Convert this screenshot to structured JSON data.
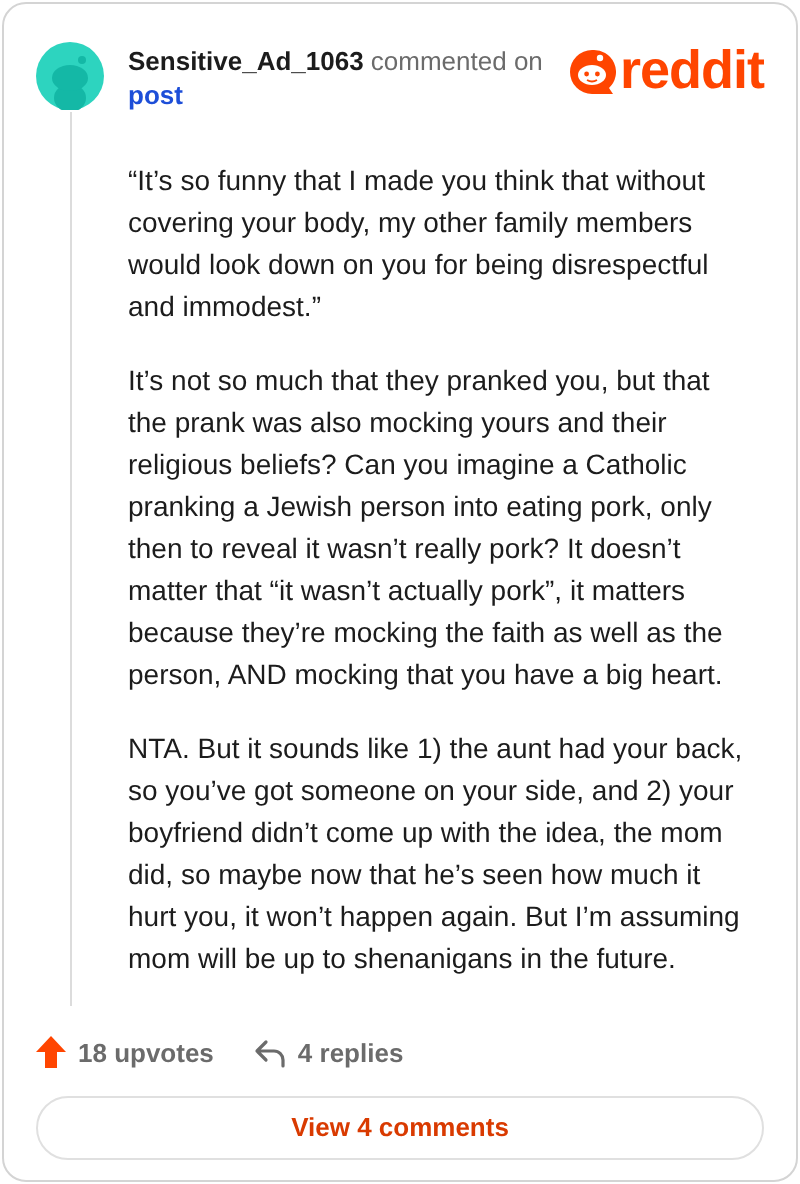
{
  "comment": {
    "author": "Sensitive_Ad_1063",
    "action": "commented on",
    "target": "post",
    "paragraphs": [
      "“It’s so funny that I made you think that without covering your body, my other family members would look down on you for being disrespectful and immodest.”",
      "It’s not so much that they pranked you, but that the prank was also mocking yours and their religious beliefs? Can you imagine a Catholic pranking a Jewish person into eating pork, only then to reveal it wasn’t really pork? It doesn’t matter that “it wasn’t actually pork”, it matters because they’re mocking the faith as well as the person, AND mocking that you have a big heart.",
      "NTA. But it sounds like 1) the aunt had your back, so you’ve got someone on your side, and 2) your boyfriend didn’t come up with the idea, the mom did, so maybe now that he’s seen how much it hurt you, it won’t happen again. But I’m assuming mom will be up to shenanigans in the future."
    ]
  },
  "logo": {
    "text": "reddit"
  },
  "actions": {
    "upvotes": "18 upvotes",
    "upvoted": true,
    "replies": "4 replies"
  },
  "view_button": "View 4 comments"
}
